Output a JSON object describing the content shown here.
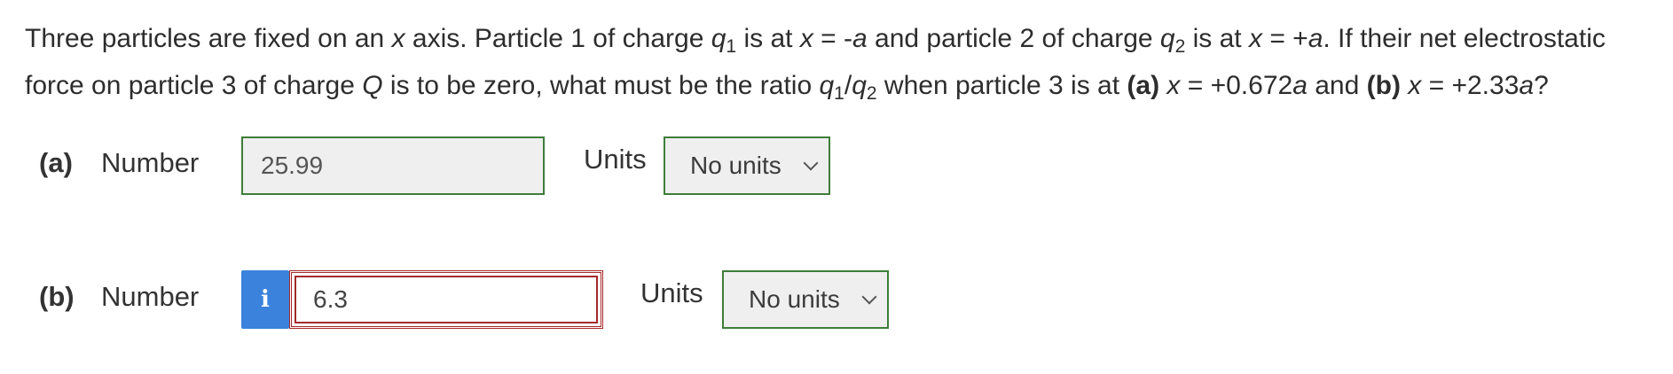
{
  "question": {
    "p1": "Three particles are fixed on an ",
    "x1": "x",
    "p2": " axis. Particle 1 of charge ",
    "q1": "q",
    "q1sub": "1",
    "p3": " is at ",
    "x2": "x",
    "p4": " = -",
    "a1": "a",
    "p5": " and particle 2 of charge ",
    "q2": "q",
    "q2sub": "2",
    "p6": " is at ",
    "x3": "x",
    "p7": " = +",
    "a2": "a",
    "p8": ". If their net electrostatic force on particle 3 of charge ",
    "Q": "Q",
    "p9": " is to be zero, what must be the ratio ",
    "r1": "q",
    "r1sub": "1",
    "slash": "/",
    "r2": "q",
    "r2sub": "2",
    "p10": " when particle 3 is at ",
    "pa": "(a)",
    "p11": " ",
    "x4": "x",
    "p12": " = +0.672",
    "a3": "a",
    "p13": " and ",
    "pb": "(b)",
    "p14": " ",
    "x5": "x",
    "p15": " = +2.33",
    "a4": "a",
    "p16": "?"
  },
  "parts": [
    {
      "label": "(a)",
      "field_label": "Number",
      "value": "25.99",
      "units_label": "Units",
      "units_value": "No units",
      "status": "correct"
    },
    {
      "label": "(b)",
      "field_label": "Number",
      "info_icon": "i",
      "value": "6.3",
      "units_label": "Units",
      "units_value": "No units",
      "status": "incorrect"
    }
  ],
  "colors": {
    "correct_border": "#3f7d3a",
    "incorrect_border": "#a52a2a",
    "info_button": "#3a82dc"
  }
}
